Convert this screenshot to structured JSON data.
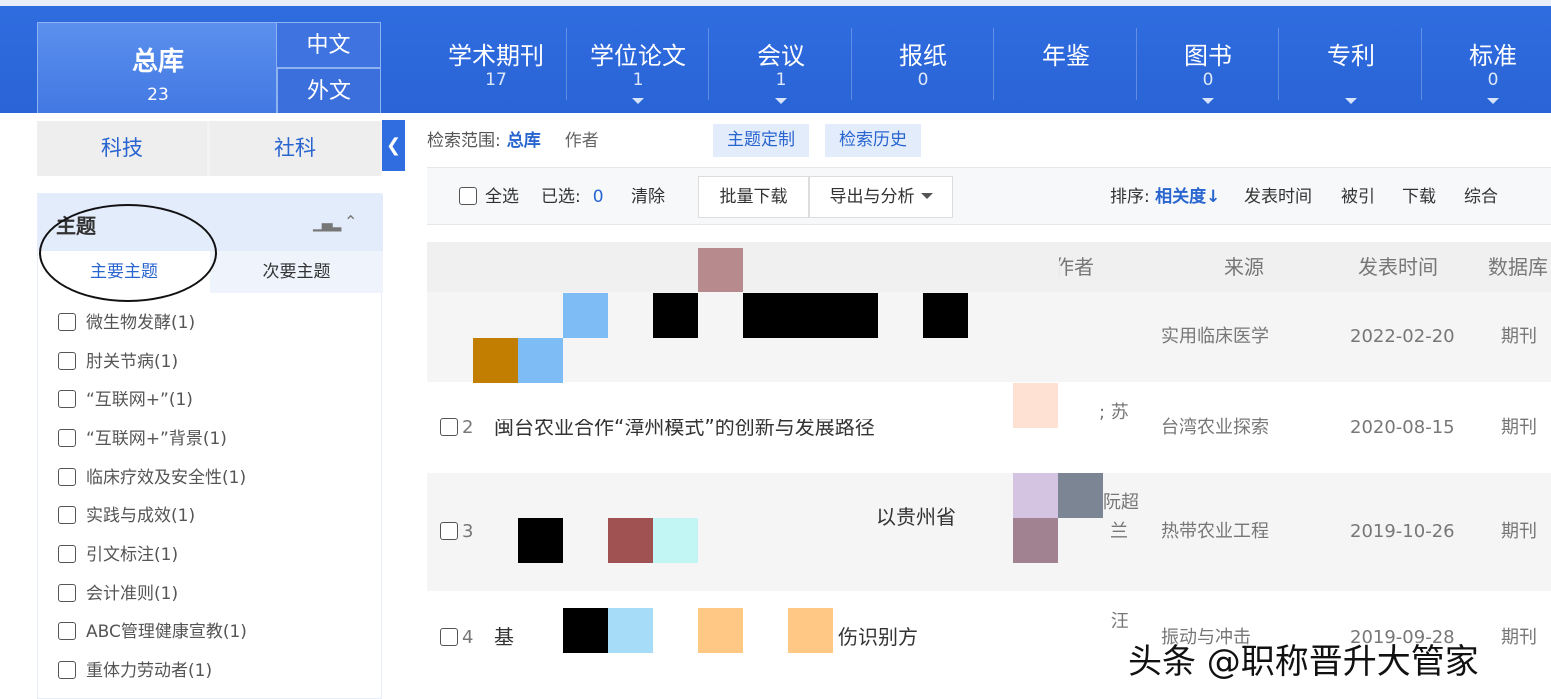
{
  "nav": {
    "zongku": {
      "label": "总库",
      "count": "23"
    },
    "lang": {
      "zh": "中文",
      "en": "外文"
    },
    "tabs": [
      {
        "label": "学术期刊",
        "count": "17"
      },
      {
        "label": "学位论文",
        "count": "1"
      },
      {
        "label": "会议",
        "count": "1"
      },
      {
        "label": "报纸",
        "count": "0"
      },
      {
        "label": "年鉴",
        "count": ""
      },
      {
        "label": "图书",
        "count": "0"
      },
      {
        "label": "专利",
        "count": ""
      },
      {
        "label": "标准",
        "count": "0"
      }
    ]
  },
  "subtabs": {
    "keji": "科技",
    "sheke": "社科"
  },
  "theme": {
    "title": "主题",
    "tab_main": "主要主题",
    "tab_secondary": "次要主题",
    "items": [
      "微生物发酵(1)",
      "肘关节病(1)",
      "“互联网+”(1)",
      "“互联网+”背景(1)",
      "临床疗效及安全性(1)",
      "实践与成效(1)",
      "引文标注(1)",
      "会计准则(1)",
      "ABC管理健康宣教(1)",
      "重体力劳动者(1)"
    ]
  },
  "search": {
    "scope_label": "检索范围:",
    "scope_value": "总库",
    "scope_author": "作者",
    "custom_button": "主题定制",
    "history_button": "检索历史"
  },
  "toolbar": {
    "select_all": "全选",
    "selected_label": "已选:",
    "selected_count": "0",
    "clear": "清除",
    "batch_download": "批量下载",
    "export": "导出与分析",
    "sort_label": "排序:",
    "sort_relevance": "相关度",
    "sort_date": "发表时间",
    "sort_cited": "被引",
    "sort_download": "下载",
    "sort_overall": "综合"
  },
  "table": {
    "headers": {
      "author": "作者",
      "source": "来源",
      "date": "发表时间",
      "db": "数据库"
    },
    "rows": [
      {
        "num": "",
        "title": "",
        "author": "",
        "source": "实用临床医学",
        "date": "2022-02-20",
        "db": "期刊"
      },
      {
        "num": "2",
        "title": "闽台农业合作“漳州模式”的创新与发展路径",
        "author": "; 苏",
        "source": "台湾农业探索",
        "date": "2020-08-15",
        "db": "期刊"
      },
      {
        "num": "3",
        "title": "以贵州省",
        "author": "阮超",
        "author2": "兰",
        "source": "热带农业工程",
        "date": "2019-10-26",
        "db": "期刊"
      },
      {
        "num": "4",
        "title": "基",
        "title2": "伤识别方",
        "author": "; 汪",
        "source": "振动与冲击",
        "date": "2019-09-28",
        "db": "期刊"
      }
    ]
  },
  "watermark": "头条 @职称晋升大管家"
}
